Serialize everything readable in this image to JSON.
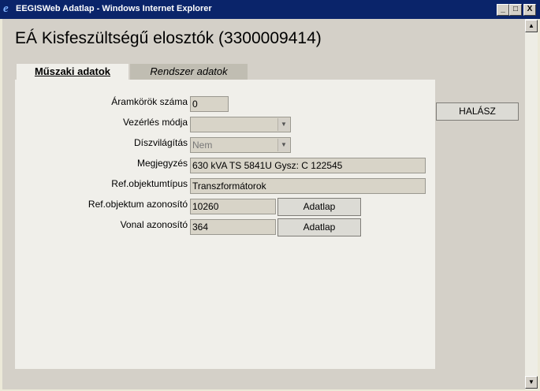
{
  "window": {
    "title": "EEGISWeb Adatlap - Windows Internet Explorer",
    "min": "_",
    "max": "□",
    "close": "X"
  },
  "page": {
    "title": "EÁ Kisfeszültségű elosztók (3300009414)"
  },
  "tabs": [
    {
      "label": "Műszaki adatok"
    },
    {
      "label": "Rendszer adatok"
    }
  ],
  "fields": {
    "aramkorok": {
      "label": "Áramkörök száma",
      "value": "0"
    },
    "vezerles": {
      "label": "Vezérlés módja",
      "value": ""
    },
    "diszvilagitas": {
      "label": "Díszvilágítás",
      "value": "Nem"
    },
    "megjegyzes": {
      "label": "Megjegyzés",
      "value": "630 kVA  TS 5841U  Gysz: C 122545"
    },
    "refobjtipus": {
      "label": "Ref.objektumtípus",
      "value": "Transzformátorok"
    },
    "refobjazon": {
      "label": "Ref.objektum azonosító",
      "value": "10260"
    },
    "vonalazon": {
      "label": "Vonal azonosító",
      "value": "364"
    }
  },
  "buttons": {
    "adatlap": "Adatlap",
    "halasz": "HALÁSZ"
  },
  "scroll": {
    "up": "▲",
    "down": "▼"
  }
}
